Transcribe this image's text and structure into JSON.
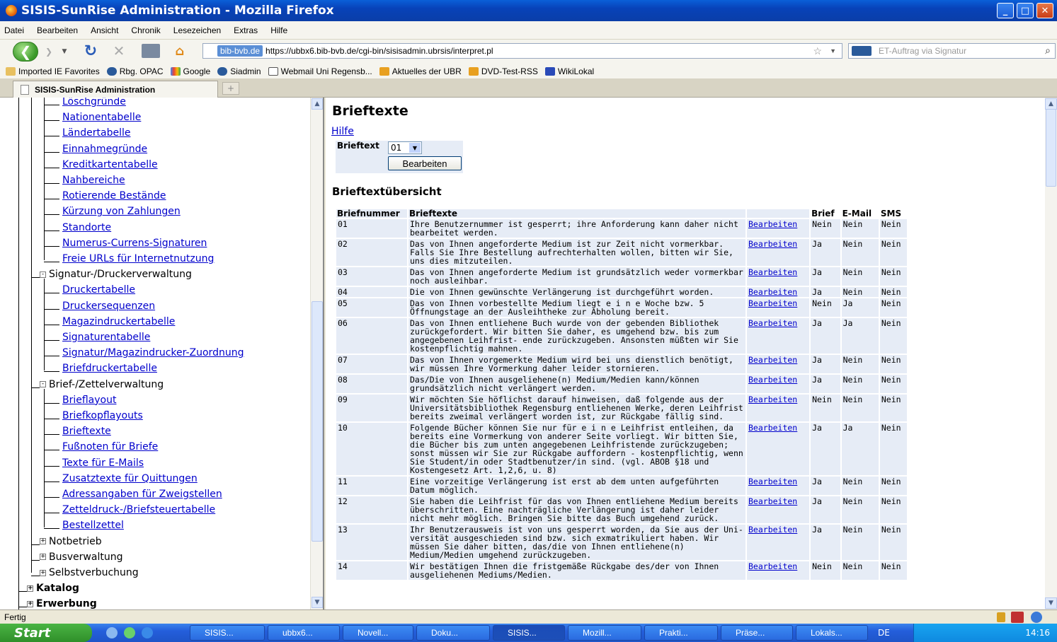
{
  "window": {
    "title": "SISIS-SunRise Administration - Mozilla Firefox"
  },
  "menu": [
    "Datei",
    "Bearbeiten",
    "Ansicht",
    "Chronik",
    "Lesezeichen",
    "Extras",
    "Hilfe"
  ],
  "nav": {
    "site_badge": "bib-bvb.de",
    "url": "https://ubbx6.bib-bvb.de/cgi-bin/sisisadmin.ubrsis/interpret.pl",
    "search_placeholder": "ET-Auftrag via Signatur"
  },
  "bookmarks": [
    "Imported IE Favorites",
    "Rbg. OPAC",
    "Google",
    "Siadmin",
    "Webmail Uni Regensb...",
    "Aktuelles der UBR",
    "DVD-Test-RSS",
    "WikiLokal"
  ],
  "tab": {
    "label": "SISIS-SunRise Administration",
    "new_tab": "+"
  },
  "sidebar": {
    "group1_links": [
      "Löschgründe",
      "Nationentabelle",
      "Ländertabelle",
      "Einnahmegründe",
      "Kreditkartentabelle",
      "Nahbereiche",
      "Rotierende Bestände",
      "Kürzung von Zahlungen",
      "Standorte",
      "Numerus-Currens-Signaturen",
      "Freie URLs für Internetnutzung"
    ],
    "signatur_label": "Signatur-/Druckerverwaltung",
    "signatur_links": [
      "Druckertabelle",
      "Druckersequenzen",
      "Magazindruckertabelle",
      "Signaturentabelle",
      "Signatur/Magazindrucker-Zuordnung",
      "Briefdruckertabelle"
    ],
    "brief_label": "Brief-/Zettelverwaltung",
    "brief_links": [
      "Brieflayout",
      "Briefkopflayouts",
      "Brieftexte",
      "Fußnoten für Briefe",
      "Texte für E-Mails",
      "Zusatztexte für Quittungen",
      "Adressangaben für Zweigstellen",
      "Zetteldruck-/Briefsteuertabelle",
      "Bestellzettel"
    ],
    "collapsed": [
      "Notbetrieb",
      "Busverwaltung",
      "Selbstverbuchung"
    ],
    "top_collapsed": [
      "Katalog",
      "Erwerbung"
    ]
  },
  "main": {
    "title": "Brieftexte",
    "help": "Hilfe",
    "form_label": "Brieftext",
    "select_value": "01",
    "edit_button": "Bearbeiten",
    "overview_title": "Brieftextübersicht",
    "columns": [
      "Briefnummer",
      "Brieftexte",
      "",
      "Brief",
      "E-Mail",
      "SMS"
    ],
    "rows": [
      {
        "num": "01",
        "text": "Ihre Benutzernummer ist gesperrt; ihre Anforderung kann daher nicht bearbeitet werden.",
        "action": "Bearbeiten",
        "brief": "Nein",
        "email": "Nein",
        "sms": "Nein"
      },
      {
        "num": "02",
        "text": "Das von Ihnen angeforderte Medium ist zur Zeit nicht vormerkbar. Falls Sie Ihre Bestellung aufrechterhalten wollen, bitten wir Sie, uns dies mitzuteilen.",
        "action": "Bearbeiten",
        "brief": "Ja",
        "email": "Nein",
        "sms": "Nein"
      },
      {
        "num": "03",
        "text": "Das von Ihnen angeforderte Medium ist grundsätzlich weder vormerkbar noch ausleihbar.",
        "action": "Bearbeiten",
        "brief": "Ja",
        "email": "Nein",
        "sms": "Nein"
      },
      {
        "num": "04",
        "text": "Die von Ihnen gewünschte Verlängerung ist durchgeführt worden.",
        "action": "Bearbeiten",
        "brief": "Ja",
        "email": "Nein",
        "sms": "Nein"
      },
      {
        "num": "05",
        "text": "Das von Ihnen vorbestellte Medium liegt e i n e Woche bzw. 5 Öffnungstage an der Ausleihtheke zur Abholung bereit.",
        "action": "Bearbeiten",
        "brief": "Nein",
        "email": "Ja",
        "sms": "Nein"
      },
      {
        "num": "06",
        "text": "Das von Ihnen entliehene Buch wurde von der gebenden Bibliothek zurückgefordert. Wir bitten Sie daher, es umgehend bzw. bis zum angegebenen Leihfrist- ende zurückzugeben. Ansonsten müßten wir Sie kostenpflichtig mahnen.",
        "action": "Bearbeiten",
        "brief": "Ja",
        "email": "Ja",
        "sms": "Nein"
      },
      {
        "num": "07",
        "text": "Das von Ihnen vorgemerkte Medium wird bei uns dienstlich benötigt, wir müssen Ihre Vormerkung daher leider stornieren.",
        "action": "Bearbeiten",
        "brief": "Ja",
        "email": "Nein",
        "sms": "Nein"
      },
      {
        "num": "08",
        "text": "Das/Die von Ihnen ausgeliehene(n) Medium/Medien kann/können grundsätzlich nicht verlängert werden.",
        "action": "Bearbeiten",
        "brief": "Ja",
        "email": "Nein",
        "sms": "Nein"
      },
      {
        "num": "09",
        "text": "Wir möchten Sie höflichst darauf hinweisen, daß folgende aus der Universitätsbibliothek Regensburg entliehenen Werke, deren Leihfrist bereits zweimal verlängert worden ist, zur Rückgabe fällig sind.",
        "action": "Bearbeiten",
        "brief": "Nein",
        "email": "Nein",
        "sms": "Nein"
      },
      {
        "num": "10",
        "text": "Folgende Bücher können Sie nur für e i n e Leihfrist entleihen, da bereits eine Vormerkung von anderer Seite vorliegt. Wir bitten Sie, die Bücher bis zum unten angegebenen Leihfristende zurückzugeben; sonst müssen wir Sie zur Rückgabe auffordern - kostenpflichtig, wenn Sie Student/in oder Stadtbenutzer/in sind. (vgl. ABOB §18 und Kostengesetz Art. 1,2,6, u. 8)",
        "action": "Bearbeiten",
        "brief": "Ja",
        "email": "Ja",
        "sms": "Nein"
      },
      {
        "num": "11",
        "text": "Eine vorzeitige Verlängerung ist erst ab dem unten aufgeführten Datum möglich.",
        "action": "Bearbeiten",
        "brief": "Ja",
        "email": "Nein",
        "sms": "Nein"
      },
      {
        "num": "12",
        "text": "Sie haben die Leihfrist für das von Ihnen entliehene Medium bereits überschritten. Eine nachträgliche Verlängerung ist daher leider nicht mehr möglich. Bringen Sie bitte das Buch umgehend zurück.",
        "action": "Bearbeiten",
        "brief": "Ja",
        "email": "Nein",
        "sms": "Nein"
      },
      {
        "num": "13",
        "text": "Ihr Benutzerausweis ist von uns gesperrt worden, da Sie aus der Uni- versität ausgeschieden sind bzw. sich exmatrikuliert haben. Wir müssen Sie daher bitten, das/die von Ihnen entliehene(n) Medium/Medien umgehend zurückzugeben.",
        "action": "Bearbeiten",
        "brief": "Ja",
        "email": "Nein",
        "sms": "Nein"
      },
      {
        "num": "14",
        "text": "Wir bestätigen Ihnen die fristgemäße Rückgabe des/der von Ihnen ausgeliehenen Mediums/Medien.",
        "action": "Bearbeiten",
        "brief": "Nein",
        "email": "Nein",
        "sms": "Nein"
      }
    ]
  },
  "status": {
    "text": "Fertig"
  },
  "taskbar": {
    "start": "Start",
    "items": [
      "SISIS...",
      "ubbx6...",
      "Novell...",
      "Doku...",
      "SISIS...",
      "Mozill...",
      "Prakti...",
      "Präse...",
      "Lokals..."
    ],
    "lang": "DE",
    "clock": "14:16"
  }
}
